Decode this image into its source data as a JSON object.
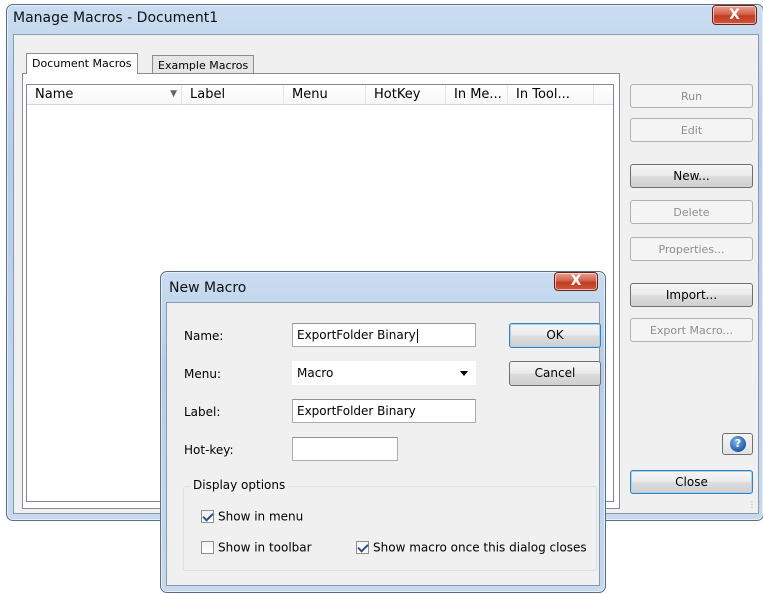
{
  "main_window": {
    "title": "Manage Macros - Document1",
    "close_glyph": "X",
    "tabs": [
      {
        "label": "Document Macros",
        "active": true
      },
      {
        "label": "Example Macros",
        "active": false
      }
    ],
    "columns": [
      "Name",
      "Label",
      "Menu",
      "HotKey",
      "In Me...",
      "In Tool..."
    ],
    "sort_indicator_icon": "sort-down-icon",
    "buttons": {
      "run": "Run",
      "edit": "Edit",
      "new": "New...",
      "delete": "Delete",
      "properties": "Properties...",
      "import": "Import...",
      "export": "Export Macro...",
      "close": "Close",
      "help_glyph": "?"
    }
  },
  "new_macro_dialog": {
    "title": "New Macro",
    "close_glyph": "X",
    "fields": {
      "name_label": "Name:",
      "name_value": "ExportFolder Binary",
      "menu_label": "Menu:",
      "menu_value": "Macro",
      "label_label": "Label:",
      "label_value": "ExportFolder Binary",
      "hotkey_label": "Hot-key:",
      "hotkey_value": ""
    },
    "buttons": {
      "ok": "OK",
      "cancel": "Cancel"
    },
    "display_options": {
      "title": "Display options",
      "show_in_menu": {
        "label": "Show in menu",
        "checked": true
      },
      "show_in_toolbar": {
        "label": "Show in toolbar",
        "checked": false
      },
      "show_macro_once": {
        "label": "Show macro once this dialog closes",
        "checked": true
      }
    }
  },
  "colors": {
    "frame": "#c3d7ee",
    "close_button": "#c9452a",
    "client": "#f0f0f0",
    "default_button_border": "#3c7fb1"
  }
}
